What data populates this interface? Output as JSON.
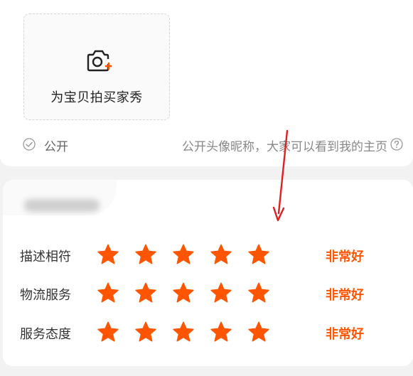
{
  "upload": {
    "label": "为宝贝拍买家秀"
  },
  "privacy": {
    "public_label": "公开",
    "hint": "公开头像昵称，大家可以看到我的主页"
  },
  "rating": {
    "rows": [
      {
        "label": "描述相符",
        "stars": 5,
        "text": "非常好"
      },
      {
        "label": "物流服务",
        "stars": 5,
        "text": "非常好"
      },
      {
        "label": "服务态度",
        "stars": 5,
        "text": "非常好"
      }
    ]
  },
  "colors": {
    "accent": "#ff5500",
    "annotation": "#e02020"
  }
}
